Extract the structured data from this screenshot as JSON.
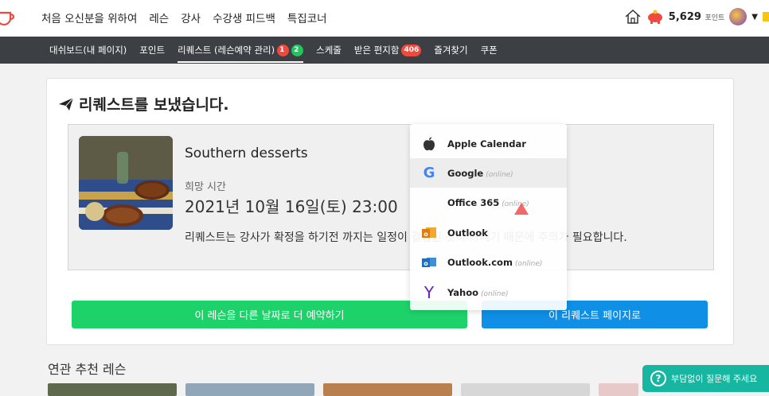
{
  "topnav": {
    "items": [
      "처음 오신분을 위하여",
      "레슨",
      "강사",
      "수강생 피드백",
      "특집코너"
    ],
    "points_value": "5,629",
    "points_unit": "포인트"
  },
  "subnav": {
    "dashboard": "대쉬보드(내 페이지)",
    "point": "포인트",
    "request": "리퀘스트 (레슨예약 관리)",
    "request_badge_red": "1",
    "request_badge_green": "2",
    "schedule": "스케줄",
    "inbox": "받은 편지함",
    "inbox_badge": "406",
    "favorites": "즐겨찾기",
    "coupon": "쿠폰"
  },
  "card": {
    "title": "리퀘스트를 보냈습니다.",
    "lesson_title": "Southern desserts",
    "hope_label": "희망 시간",
    "datetime": "2021년 10월 16일(토) 23:00",
    "notice": "리퀘스트는 강사가 확정을 하기전 까지는 일정이 결정된 것이 아니기 때문에 주의가 필요합니다.",
    "btn_rebook": "이 레슨을 다른 날짜로 더 예약하기",
    "btn_request_page": "이 리퀘스트 페이지로"
  },
  "related_title": "연관 추천 레슨",
  "calendar_menu": {
    "items": [
      {
        "label": "Apple Calendar",
        "online": ""
      },
      {
        "label": "Google",
        "online": "(online)"
      },
      {
        "label": "Office 365",
        "online": "(online)"
      },
      {
        "label": "Outlook",
        "online": ""
      },
      {
        "label": "Outlook.com",
        "online": "(online)"
      },
      {
        "label": "Yahoo",
        "online": "(online)"
      }
    ]
  },
  "help_button": "부담없이 질문해 주세요",
  "colors": {
    "green": "#1ed26a",
    "blue": "#0f8fe6",
    "subbar": "#3c3f43",
    "red_badge": "#ef4a3d",
    "help": "#16b6a0"
  }
}
